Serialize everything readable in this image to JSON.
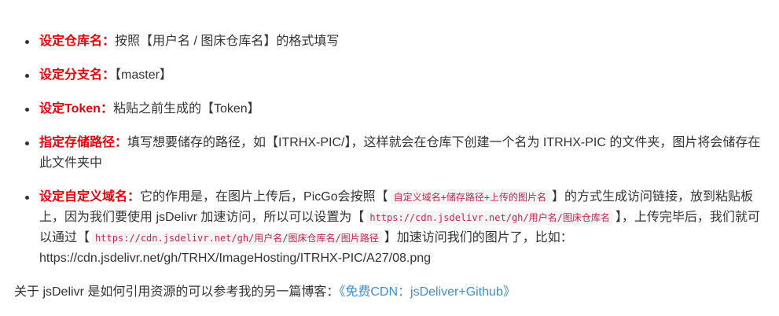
{
  "items": [
    {
      "term": "设定仓库名：",
      "text": "按照【用户名 / 图床仓库名】的格式填写"
    },
    {
      "term": "设定分支名：",
      "text": "【master】"
    },
    {
      "term": "设定Token：",
      "text": "粘贴之前生成的【Token】"
    },
    {
      "term": "指定存储路径：",
      "text": "填写想要储存的路径，如【ITRHX-PIC/】，这样就会在仓库下创建一个名为 ITRHX-PIC 的文件夹，图片将会储存在此文件夹中"
    },
    {
      "term": "设定自定义域名：",
      "text_1": "它的作用是，在图片上传后，PicGo会按照【",
      "code_1": "自定义域名+储存路径+上传的图片名",
      "text_2": "】的方式生成访问链接，放到粘贴板上，因为我们要使用 jsDelivr 加速访问，所以可以设置为【",
      "code_2": "https://cdn.jsdelivr.net/gh/用户名/图床仓库名",
      "text_3": "】，上传完毕后，我们就可以通过【",
      "code_3": "https://cdn.jsdelivr.net/gh/用户名/图床仓库名/图片路径",
      "text_4": "】加速访问我们的图片了，比如：https://cdn.jsdelivr.net/gh/TRHX/ImageHosting/ITRHX-PIC/A27/08.png"
    }
  ],
  "footnote": {
    "text": "关于 jsDelivr 是如何引用资源的可以参考我的另一篇博客：",
    "link": "《免费CDN：jsDeliver+Github》"
  },
  "colors": {
    "term": "#e8000b",
    "link": "#3b8fd1",
    "code": "#c7254e"
  }
}
